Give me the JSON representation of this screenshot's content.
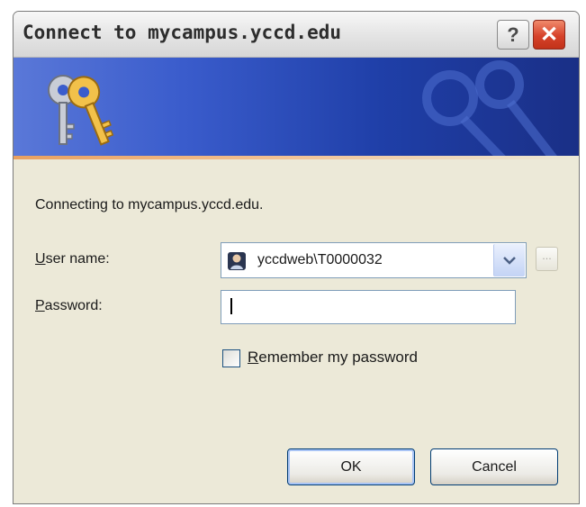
{
  "window": {
    "title": "Connect to mycampus.yccd.edu",
    "help_glyph": "?",
    "close_glyph": "✕",
    "icons": [
      "keys-icon",
      "question-icon",
      "close-icon"
    ]
  },
  "message": "Connecting to mycampus.yccd.edu.",
  "username": {
    "label_first": "U",
    "label_rest": "ser name:",
    "value": "yccdweb\\T0000032",
    "browse_label": "..."
  },
  "password": {
    "label_first": "P",
    "label_rest": "assword:",
    "value": ""
  },
  "remember": {
    "label_first": "R",
    "label_rest": "emember my password",
    "checked": false
  },
  "buttons": {
    "ok": "OK",
    "cancel": "Cancel"
  },
  "colors": {
    "banner_start": "#5a78d8",
    "banner_end": "#1a2f86",
    "close_red": "#d6422a"
  }
}
